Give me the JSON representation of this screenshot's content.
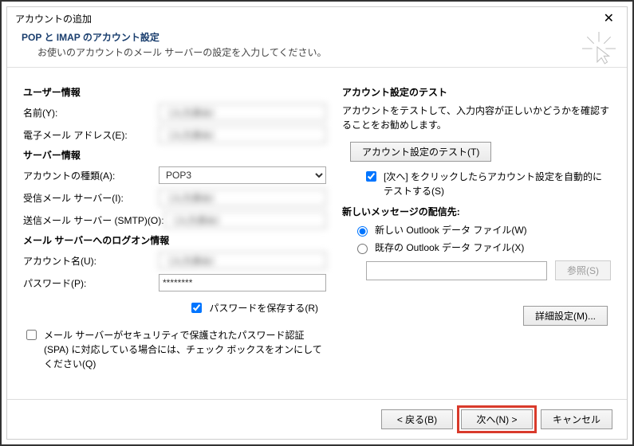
{
  "window": {
    "title": "アカウントの追加"
  },
  "header": {
    "title": "POP と IMAP のアカウント設定",
    "subtitle": "お使いのアカウントのメール サーバーの設定を入力してください。"
  },
  "left": {
    "user_section": "ユーザー情報",
    "name_label": "名前(Y):",
    "name_value": "（入力済み）",
    "email_label": "電子メール アドレス(E):",
    "email_value": "（入力済み）",
    "server_section": "サーバー情報",
    "account_type_label": "アカウントの種類(A):",
    "account_type_value": "POP3",
    "incoming_label": "受信メール サーバー(I):",
    "incoming_value": "（入力済み）",
    "outgoing_label": "送信メール サーバー (SMTP)(O):",
    "outgoing_value": "（入力済み）",
    "logon_section": "メール サーバーへのログオン情報",
    "account_name_label": "アカウント名(U):",
    "account_name_value": "（入力済み）",
    "password_label": "パスワード(P):",
    "password_value": "********",
    "save_password_label": "パスワードを保存する(R)",
    "spa_label": "メール サーバーがセキュリティで保護されたパスワード認証 (SPA) に対応している場合には、チェック ボックスをオンにしてください(Q)"
  },
  "right": {
    "test_section": "アカウント設定のテスト",
    "test_text": "アカウントをテストして、入力内容が正しいかどうかを確認することをお勧めします。",
    "test_button": "アカウント設定のテスト(T)",
    "auto_test_label": "[次へ] をクリックしたらアカウント設定を自動的にテストする(S)",
    "delivery_section": "新しいメッセージの配信先:",
    "radio_new": "新しい Outlook データ ファイル(W)",
    "radio_existing": "既存の Outlook データ ファイル(X)",
    "browse_button": "参照(S)",
    "advanced_button": "詳細設定(M)..."
  },
  "footer": {
    "back": "< 戻る(B)",
    "next": "次へ(N) >",
    "cancel": "キャンセル"
  }
}
